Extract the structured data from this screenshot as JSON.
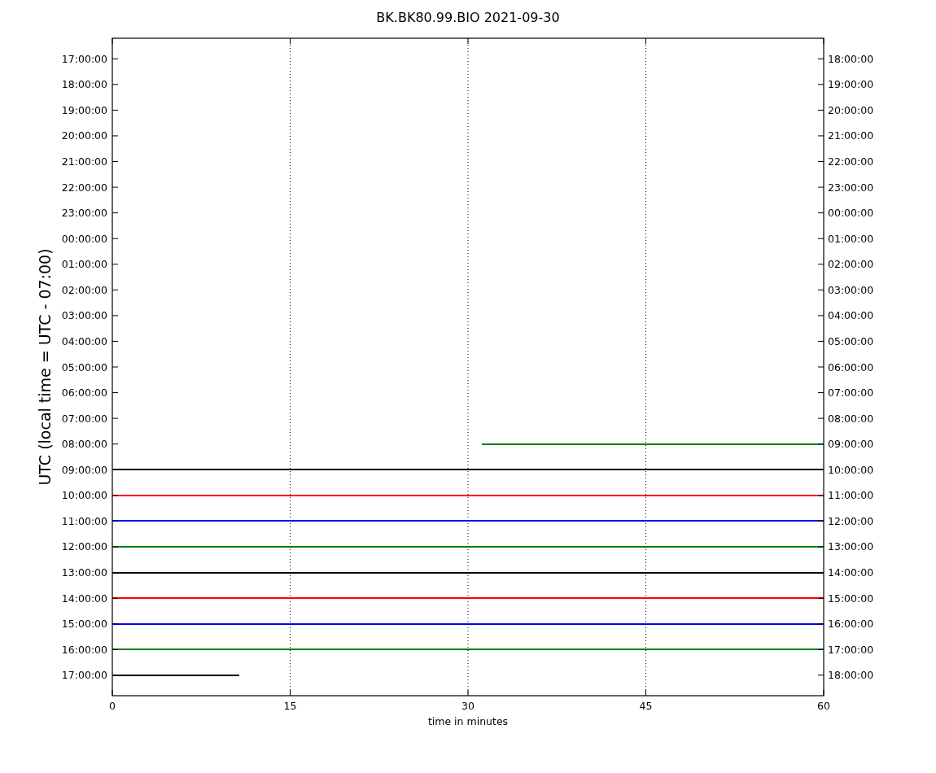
{
  "figure": {
    "title": "BK.BK80.99.BIO 2021-09-30",
    "ylabel": "UTC (local time = UTC - 07:00)",
    "xlabel": "time in minutes",
    "x_tick_labels": [
      "0",
      "15",
      "30",
      "45",
      "60"
    ],
    "rows": [
      {
        "left": "17:00:00",
        "right": "18:00:00"
      },
      {
        "left": "18:00:00",
        "right": "19:00:00"
      },
      {
        "left": "19:00:00",
        "right": "20:00:00"
      },
      {
        "left": "20:00:00",
        "right": "21:00:00"
      },
      {
        "left": "21:00:00",
        "right": "22:00:00"
      },
      {
        "left": "22:00:00",
        "right": "23:00:00"
      },
      {
        "left": "23:00:00",
        "right": "00:00:00"
      },
      {
        "left": "00:00:00",
        "right": "01:00:00"
      },
      {
        "left": "01:00:00",
        "right": "02:00:00"
      },
      {
        "left": "02:00:00",
        "right": "03:00:00"
      },
      {
        "left": "03:00:00",
        "right": "04:00:00"
      },
      {
        "left": "04:00:00",
        "right": "05:00:00"
      },
      {
        "left": "05:00:00",
        "right": "06:00:00"
      },
      {
        "left": "06:00:00",
        "right": "07:00:00"
      },
      {
        "left": "07:00:00",
        "right": "08:00:00"
      },
      {
        "left": "08:00:00",
        "right": "09:00:00",
        "trace": {
          "kind": "late-start",
          "color": "#008000"
        }
      },
      {
        "left": "09:00:00",
        "right": "10:00:00",
        "trace": {
          "kind": "full",
          "color": "#000000"
        }
      },
      {
        "left": "10:00:00",
        "right": "11:00:00",
        "trace": {
          "kind": "full",
          "color": "#ff0000"
        }
      },
      {
        "left": "11:00:00",
        "right": "12:00:00",
        "trace": {
          "kind": "full",
          "color": "#0000ff"
        }
      },
      {
        "left": "12:00:00",
        "right": "13:00:00",
        "trace": {
          "kind": "full",
          "color": "#008000"
        }
      },
      {
        "left": "13:00:00",
        "right": "14:00:00",
        "trace": {
          "kind": "full",
          "color": "#000000"
        }
      },
      {
        "left": "14:00:00",
        "right": "15:00:00",
        "trace": {
          "kind": "full",
          "color": "#ff0000"
        }
      },
      {
        "left": "15:00:00",
        "right": "16:00:00",
        "trace": {
          "kind": "full",
          "color": "#0000ff"
        }
      },
      {
        "left": "16:00:00",
        "right": "17:00:00",
        "trace": {
          "kind": "full",
          "color": "#008000"
        }
      },
      {
        "left": "17:00:00",
        "right": "18:00:00",
        "trace": {
          "kind": "early-end",
          "color": "#000000"
        }
      }
    ]
  }
}
